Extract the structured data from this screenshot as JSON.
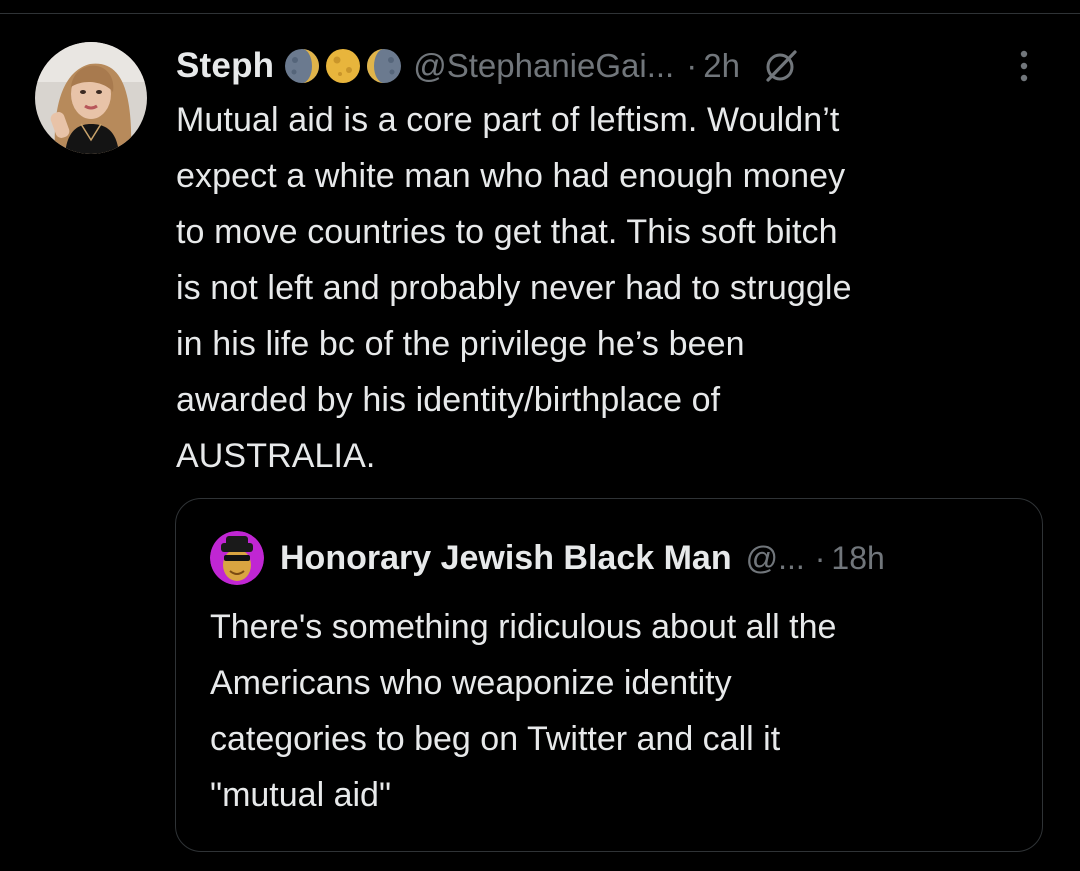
{
  "tweet": {
    "author": {
      "display_name": "Steph",
      "handle": "@StephanieGai...",
      "avatar_icon": "profile-photo",
      "badges": [
        "waning-moon-emoji",
        "full-moon-emoji",
        "waxing-moon-emoji"
      ]
    },
    "separator": "·",
    "timestamp": "2h",
    "grok_icon": "grok-icon",
    "more_icon": "more-options-icon",
    "text": "Mutual aid is a core part of leftism. Wouldn’t\nexpect a white man who had enough money\nto move countries to get that. This soft bitch\nis not left and probably never had to struggle\nin his life bc of the privilege he’s been\nawarded by his identity/birthplace of\nAUSTRALIA."
  },
  "quoted_tweet": {
    "author": {
      "display_name": "Honorary Jewish Black Man",
      "handle": "@...",
      "avatar_icon": "cartoon-avatar",
      "avatar_color": "#c026d3"
    },
    "separator": "·",
    "timestamp": "18h",
    "text": "There's something ridiculous about all the\nAmericans who weaponize identity\ncategories to beg on Twitter and call it\n\"mutual aid\""
  },
  "colors": {
    "background": "#000000",
    "text": "#e7e9ea",
    "secondary": "#71767b",
    "border": "#2f3336"
  }
}
